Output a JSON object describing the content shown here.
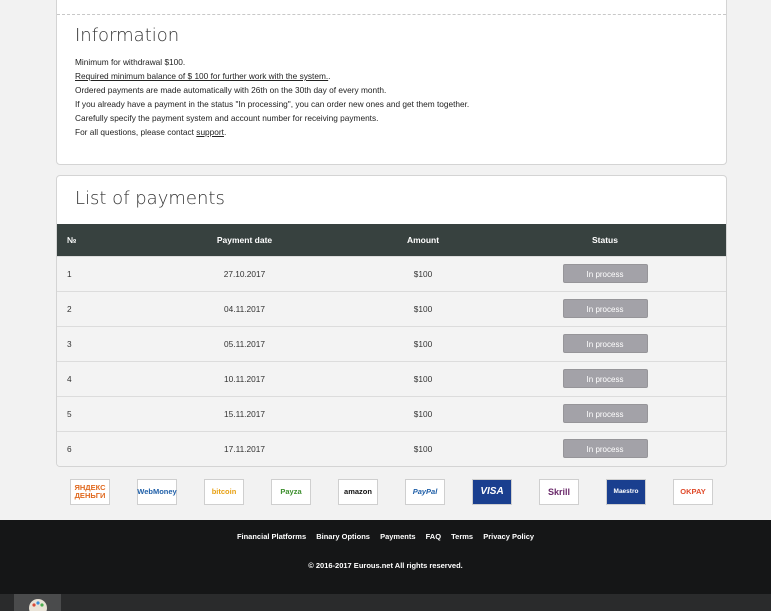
{
  "information": {
    "title": "Information",
    "lines": [
      "Minimum for withdrawal $100.",
      "Required minimum balance of $ 100 for further work with the system.",
      "Ordered payments are made automatically with 26th on the 30th day of every month.",
      "If you already have a payment in the status \"In processing\", you can order new ones and get them together.",
      "Carefully specify the payment system and account number for receiving payments.",
      "For all questions, please contact "
    ],
    "support_link": "support",
    "period": "."
  },
  "payments": {
    "title": "List of payments",
    "columns": [
      "№",
      "Payment date",
      "Amount",
      "Status"
    ],
    "rows": [
      {
        "no": "1",
        "date": "27.10.2017",
        "amount": "$100",
        "status": "In process"
      },
      {
        "no": "2",
        "date": "04.11.2017",
        "amount": "$100",
        "status": "In process"
      },
      {
        "no": "3",
        "date": "05.11.2017",
        "amount": "$100",
        "status": "In process"
      },
      {
        "no": "4",
        "date": "10.11.2017",
        "amount": "$100",
        "status": "In process"
      },
      {
        "no": "5",
        "date": "15.11.2017",
        "amount": "$100",
        "status": "In process"
      },
      {
        "no": "6",
        "date": "17.11.2017",
        "amount": "$100",
        "status": "In process"
      }
    ]
  },
  "payment_systems": [
    {
      "label": "ЯНДЕКС ДЕНЬГИ",
      "color": "#e0691f"
    },
    {
      "label": "WebMoney",
      "color": "#1f5fa8"
    },
    {
      "label": "bitcoin",
      "color": "#e8a114"
    },
    {
      "label": "Payza",
      "color": "#3d8f2e"
    },
    {
      "label": "amazon",
      "color": "#111111"
    },
    {
      "label": "PayPal",
      "color": "#1f5fa8"
    },
    {
      "label": "VISA",
      "color": "#ffffff"
    },
    {
      "label": "Skrill",
      "color": "#6b2a6b"
    },
    {
      "label": "Maestro",
      "color": "#ffffff"
    },
    {
      "label": "OKPAY",
      "color": "#e04a2a"
    }
  ],
  "footer": {
    "links": [
      "Financial Platforms",
      "Binary Options",
      "Payments",
      "FAQ",
      "Terms",
      "Privacy Policy"
    ],
    "copyright": "© 2016-2017 Eurous.net All rights reserved."
  }
}
